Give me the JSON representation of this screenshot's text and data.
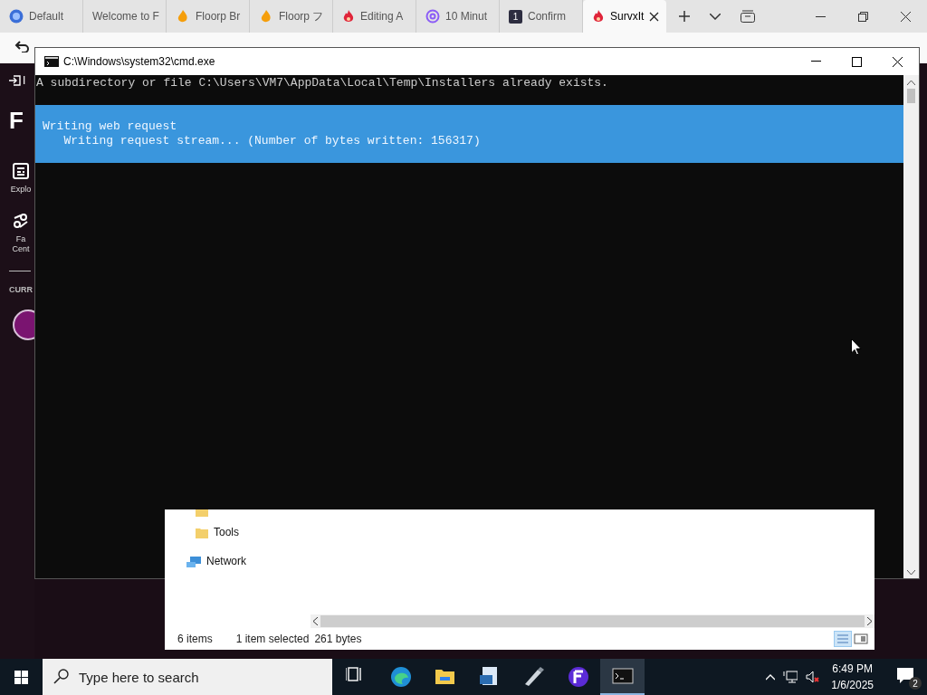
{
  "browser": {
    "tabs": [
      {
        "label": "Default",
        "kind": "globe",
        "selected": false
      },
      {
        "label": "Welcome to F",
        "kind": "plain",
        "selected": false
      },
      {
        "label": "Floorp Br",
        "kind": "floorp",
        "selected": false
      },
      {
        "label": "Floorp フ",
        "kind": "floorp",
        "selected": false
      },
      {
        "label": "Editing A",
        "kind": "flame",
        "selected": false
      },
      {
        "label": "10 Minut",
        "kind": "mail",
        "selected": false
      },
      {
        "label": "Confirm",
        "kind": "badge",
        "badge": "1",
        "selected": false
      },
      {
        "label": "SurvxIt",
        "kind": "flame",
        "selected": true
      }
    ],
    "sidebar": {
      "logo": "F",
      "items": [
        {
          "label": "Explo",
          "kind": "explore"
        },
        {
          "label": "Fa\nCent",
          "kind": "center"
        }
      ],
      "section": "CURR"
    },
    "toolbar_label": "I"
  },
  "console_window": {
    "title": "C:\\Windows\\system32\\cmd.exe",
    "lines": [
      "A subdirectory or file C:\\Users\\VM7\\AppData\\Local\\Temp\\Installers already exists."
    ],
    "progress": {
      "title": "Writing web request",
      "detail": "   Writing request stream... (Number of bytes written: 156317)"
    }
  },
  "explorer": {
    "tree": [
      {
        "label": "Tools",
        "kind": "folder"
      },
      {
        "label": "Network",
        "kind": "network"
      }
    ],
    "status": {
      "count": "6 items",
      "selection": "1 item selected",
      "size": "261 bytes"
    },
    "views": [
      {
        "kind": "details",
        "selected": true
      },
      {
        "kind": "preview",
        "selected": false
      }
    ]
  },
  "taskbar": {
    "search_placeholder": "Type here to search",
    "apps": [
      {
        "kind": "task-view",
        "selected": false
      },
      {
        "kind": "edge",
        "selected": false
      },
      {
        "kind": "files",
        "selected": false
      },
      {
        "kind": "document",
        "selected": false
      },
      {
        "kind": "pen",
        "selected": false
      },
      {
        "kind": "floorp",
        "selected": false
      },
      {
        "kind": "terminal",
        "selected": true
      }
    ],
    "time": "6:49 PM",
    "date": "1/6/2025",
    "notifications": "2"
  }
}
